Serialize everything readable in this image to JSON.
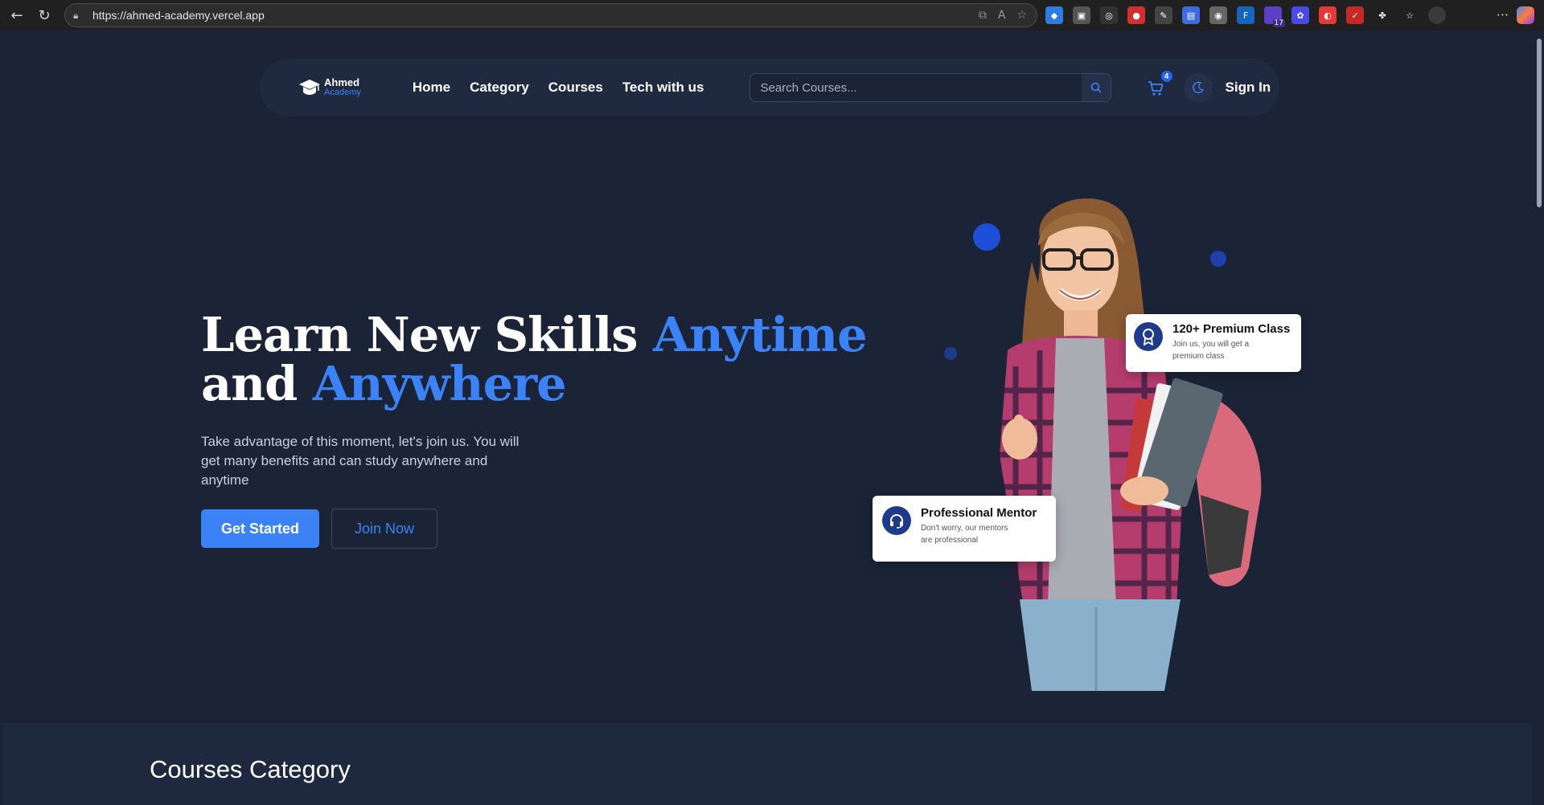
{
  "browser": {
    "url": "https://ahmed-academy.vercel.app",
    "extension_badge": "17"
  },
  "nav": {
    "logo": {
      "name_line1": "Ahmed",
      "name_line2": "Academy"
    },
    "links": [
      "Home",
      "Category",
      "Courses",
      "Tech with us"
    ],
    "search_placeholder": "Search Courses...",
    "cart_count": "4",
    "signin_label": "Sign In"
  },
  "hero": {
    "title_part1": "Learn New Skills ",
    "title_accent1": "Anytime",
    "title_part2": "and ",
    "title_accent2": "Anywhere",
    "description": "Take advantage of this moment, let's join us. You will get many benefits and can study anywhere and anytime",
    "primary_button": "Get Started",
    "secondary_button": "Join Now"
  },
  "cards": {
    "premium": {
      "title": "120+ Premium Class",
      "subtitle_line1": "Join us, you will get a",
      "subtitle_line2": "premium class"
    },
    "mentor": {
      "title": "Professional Mentor",
      "subtitle_line1": "Don't worry, our mentors",
      "subtitle_line2": "are professional"
    }
  },
  "sections": {
    "categories_title": "Courses Category"
  },
  "colors": {
    "background": "#1b2437",
    "accent": "#3b82f6",
    "navbar": "#1f2a40"
  }
}
